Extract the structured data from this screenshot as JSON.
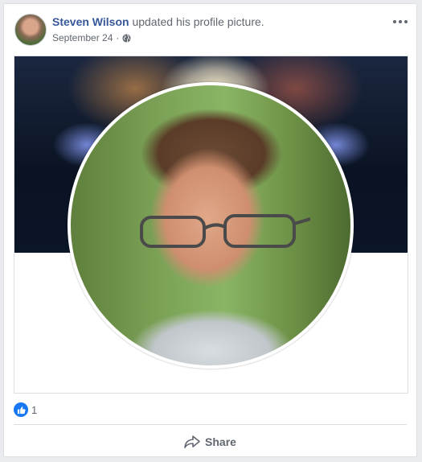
{
  "post": {
    "author": "Steven Wilson",
    "action": "updated his profile picture.",
    "date": "September 24",
    "privacy_icon": "globe-icon",
    "menu_icon": "more-options-icon"
  },
  "reactions": {
    "icon": "like-icon",
    "count": "1"
  },
  "actions": {
    "share_label": "Share",
    "share_icon": "share-arrow-icon"
  },
  "colors": {
    "author_link": "#365899",
    "like_blue": "#1877f2",
    "page_bg": "#e9ebee"
  }
}
